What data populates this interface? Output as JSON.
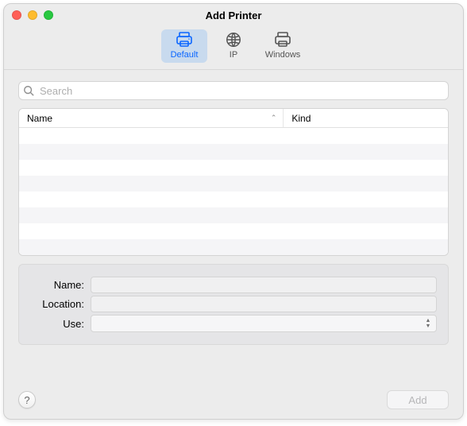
{
  "window": {
    "title": "Add Printer"
  },
  "toolbar": {
    "items": [
      {
        "id": "default",
        "label": "Default",
        "selected": true
      },
      {
        "id": "ip",
        "label": "IP",
        "selected": false
      },
      {
        "id": "windows",
        "label": "Windows",
        "selected": false
      }
    ]
  },
  "search": {
    "placeholder": "Search",
    "value": ""
  },
  "list": {
    "columns": {
      "name": "Name",
      "kind": "Kind"
    },
    "sort_column": "name",
    "sort_direction": "asc",
    "rows": []
  },
  "form": {
    "name": {
      "label": "Name:",
      "value": ""
    },
    "location": {
      "label": "Location:",
      "value": ""
    },
    "use": {
      "label": "Use:",
      "value": ""
    }
  },
  "footer": {
    "help_label": "?",
    "add_label": "Add",
    "add_enabled": false
  }
}
